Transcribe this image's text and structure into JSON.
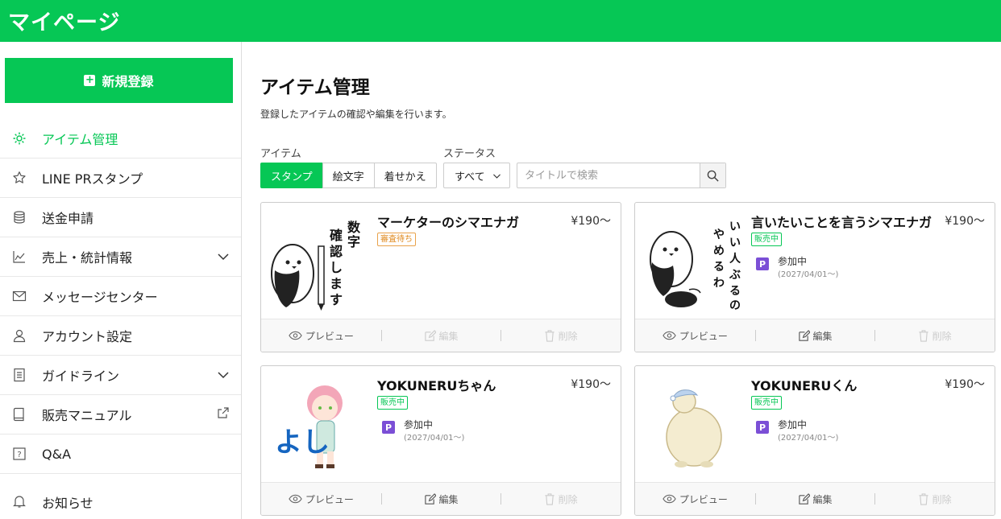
{
  "header": {
    "title": "マイページ"
  },
  "sidebar": {
    "new_button": "新規登録",
    "items": [
      {
        "label": "アイテム管理",
        "icon": "gear-icon",
        "active": true
      },
      {
        "label": "LINE PRスタンプ",
        "icon": "star-icon"
      },
      {
        "label": "送金申請",
        "icon": "coins-icon"
      },
      {
        "label": "売上・統計情報",
        "icon": "chart-icon",
        "expandable": true
      },
      {
        "label": "メッセージセンター",
        "icon": "mail-icon"
      },
      {
        "label": "アカウント設定",
        "icon": "user-icon"
      },
      {
        "label": "ガイドライン",
        "icon": "document-icon",
        "expandable": true
      },
      {
        "label": "販売マニュアル",
        "icon": "book-icon",
        "external": true
      },
      {
        "label": "Q&A",
        "icon": "question-icon"
      },
      {
        "label": "お知らせ",
        "icon": "bell-icon"
      }
    ]
  },
  "main": {
    "title": "アイテム管理",
    "description": "登録したアイテムの確認や編集を行います。",
    "filters": {
      "item_label": "アイテム",
      "item_tabs": [
        "スタンプ",
        "絵文字",
        "着せかえ"
      ],
      "active_tab": "スタンプ",
      "status_label": "ステータス",
      "status_value": "すべて",
      "search_placeholder": "タイトルで検索"
    },
    "cards": [
      {
        "name": "マーケターのシマエナガ",
        "price": "¥190〜",
        "status": "審査待ち",
        "status_type": "pending",
        "pr": null,
        "thumb_text": "数字確認します",
        "actions": {
          "preview": "プレビュー",
          "edit": "編集",
          "delete": "削除"
        }
      },
      {
        "name": "言いたいことを言うシマエナガ",
        "price": "¥190〜",
        "status": "販売中",
        "status_type": "sale",
        "pr": {
          "label": "P",
          "text": "参加中",
          "date": "(2027/04/01〜)"
        },
        "thumb_text": "いい人ぶるのやめるわ",
        "actions": {
          "preview": "プレビュー",
          "edit": "編集",
          "delete": "削除"
        }
      },
      {
        "name": "YOKUNERUちゃん",
        "price": "¥190〜",
        "status": "販売中",
        "status_type": "sale",
        "pr": {
          "label": "P",
          "text": "参加中",
          "date": "(2027/04/01〜)"
        },
        "thumb_text": "よし",
        "actions": {
          "preview": "プレビュー",
          "edit": "編集",
          "delete": "削除"
        }
      },
      {
        "name": "YOKUNERUくん",
        "price": "¥190〜",
        "status": "販売中",
        "status_type": "sale",
        "pr": {
          "label": "P",
          "text": "参加中",
          "date": "(2027/04/01〜)"
        },
        "thumb_text": "",
        "actions": {
          "preview": "プレビュー",
          "edit": "編集",
          "delete": "削除"
        }
      }
    ]
  },
  "colors": {
    "brand": "#06c755",
    "pending": "#e08a1e",
    "pr_badge": "#7b4fd6"
  }
}
